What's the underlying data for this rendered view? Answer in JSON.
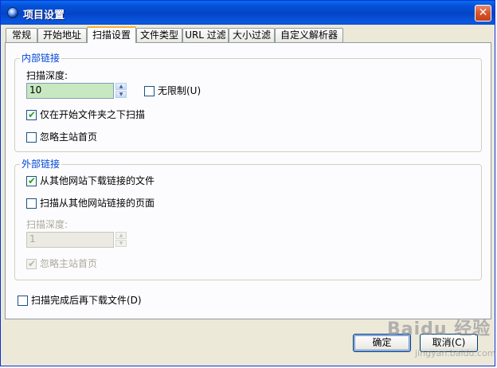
{
  "window": {
    "title": "项目设置",
    "close_glyph": "✕"
  },
  "tabs": [
    {
      "label": "常规"
    },
    {
      "label": "开始地址"
    },
    {
      "label": "扫描设置"
    },
    {
      "label": "文件类型"
    },
    {
      "label": "URL 过滤"
    },
    {
      "label": "大小过滤"
    },
    {
      "label": "自定义解析器"
    }
  ],
  "active_tab": "扫描设置",
  "internal": {
    "title": "内部链接",
    "depth_label": "扫描深度:",
    "depth_value": "10",
    "unlimited_label": "无限制(U)",
    "unlimited_checked": false,
    "only_below_start_label": "仅在开始文件夹之下扫描",
    "only_below_start_checked": true,
    "ignore_home_label": "忽略主站首页",
    "ignore_home_checked": false
  },
  "external": {
    "title": "外部链接",
    "download_linked_files_label": "从其他网站下载链接的文件",
    "download_linked_files_checked": true,
    "scan_linked_pages_label": "扫描从其他网站链接的页面",
    "scan_linked_pages_checked": false,
    "depth_label": "扫描深度:",
    "depth_value": "1",
    "ignore_home_label": "忽略主站首页",
    "ignore_home_checked": true
  },
  "download_after_scan_label": "扫描完成后再下载文件(D)",
  "download_after_scan_checked": false,
  "buttons": {
    "ok": "确定",
    "cancel": "取消(C)"
  },
  "watermark": {
    "text": "Baidu 经验",
    "sub": "jingyan.baidu.com"
  },
  "colors": {
    "titlebar": "#0a58e0",
    "group_title": "#0046d5",
    "check": "#21a121",
    "spin_bg": "#c7e8c0"
  }
}
